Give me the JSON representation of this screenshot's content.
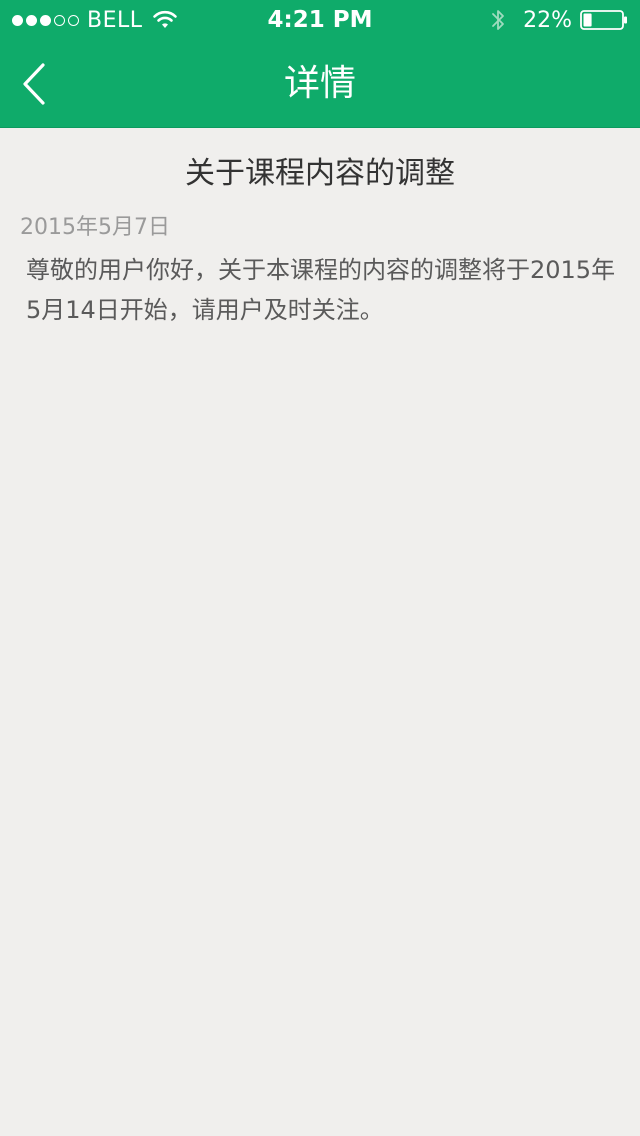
{
  "status_bar": {
    "carrier": "BELL",
    "time": "4:21 PM",
    "battery_percent": "22%",
    "battery_level": 0.22,
    "signal_strength": 3,
    "signal_max": 5,
    "icons": [
      "wifi-icon",
      "bluetooth-icon",
      "battery-icon"
    ]
  },
  "nav": {
    "title": "详情",
    "back_icon": "chevron-left-icon"
  },
  "article": {
    "title": "关于课程内容的调整",
    "date": "2015年5月7日",
    "body": "尊敬的用户你好，关于本课程的内容的调整将于2015年5月14日开始，请用户及时关注。"
  },
  "colors": {
    "brand_green": "#0fab6a",
    "background": "#f0efed",
    "title_text": "#333333",
    "date_text": "#9a9a9a",
    "body_text": "#5a5a5a"
  }
}
